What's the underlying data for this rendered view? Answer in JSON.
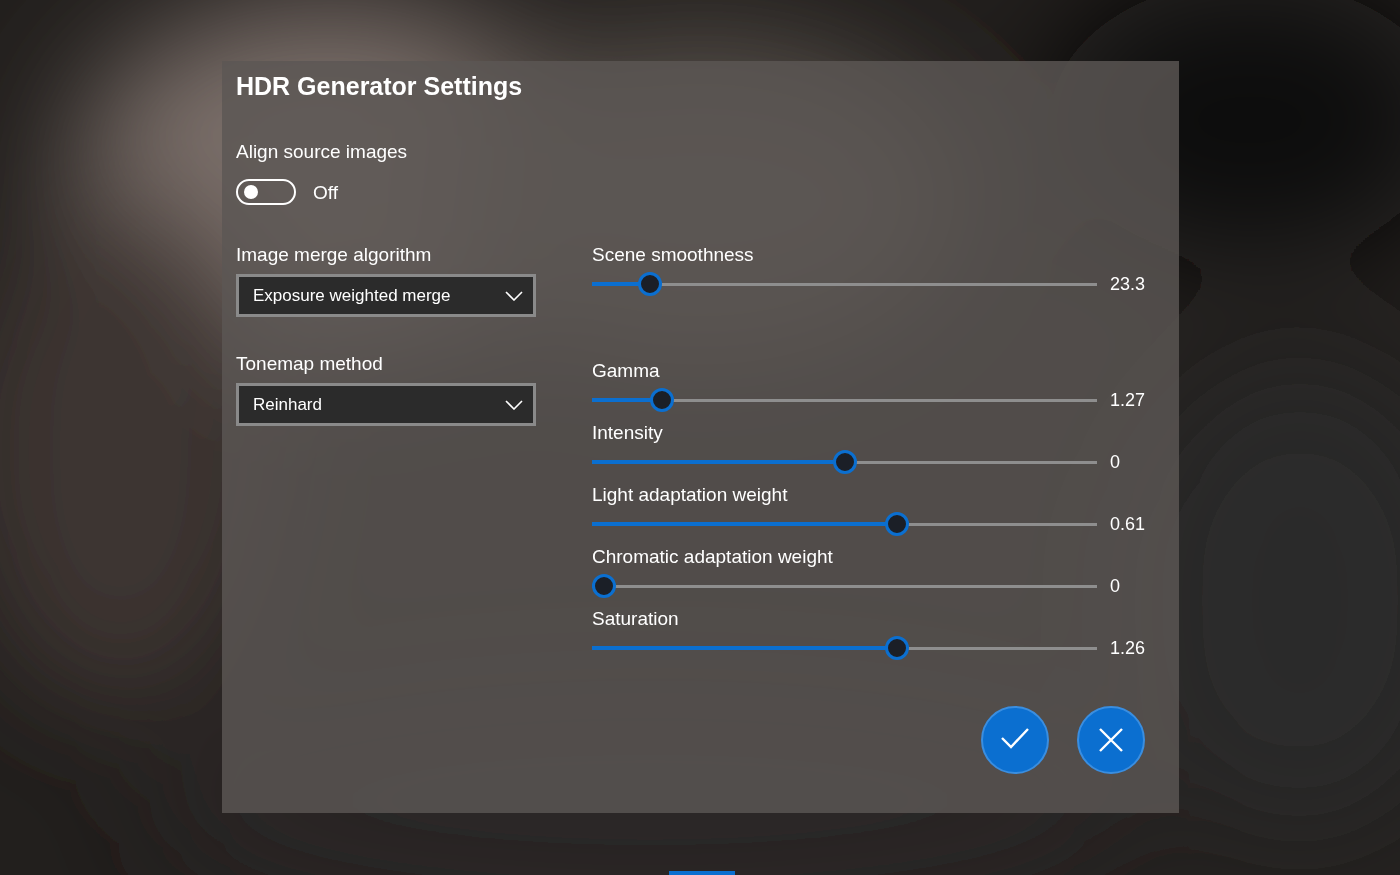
{
  "dialog": {
    "title": "HDR Generator Settings",
    "toggle": {
      "label": "Align source images",
      "on": false,
      "state_text": "Off"
    },
    "dropdowns": [
      {
        "label": "Image merge algorithm",
        "value": "Exposure weighted merge"
      },
      {
        "label": "Tonemap method",
        "value": "Reinhard"
      }
    ],
    "merge_sliders": [
      {
        "label": "Scene smoothness",
        "level": 0.096,
        "reading": "23.3"
      }
    ],
    "tonemap_sliders": [
      {
        "label": "Gamma",
        "level": 0.12,
        "reading": "1.27"
      },
      {
        "label": "Intensity",
        "level": 0.5,
        "reading": "0"
      },
      {
        "label": "Light adaptation weight",
        "level": 0.61,
        "reading": "0.61"
      },
      {
        "label": "Chromatic adaptation weight",
        "level": 0,
        "reading": "0"
      },
      {
        "label": "Saturation",
        "level": 0.61,
        "reading": "1.26"
      }
    ],
    "buttons": [
      {
        "kind": "confirm"
      },
      {
        "kind": "cancel"
      }
    ]
  }
}
